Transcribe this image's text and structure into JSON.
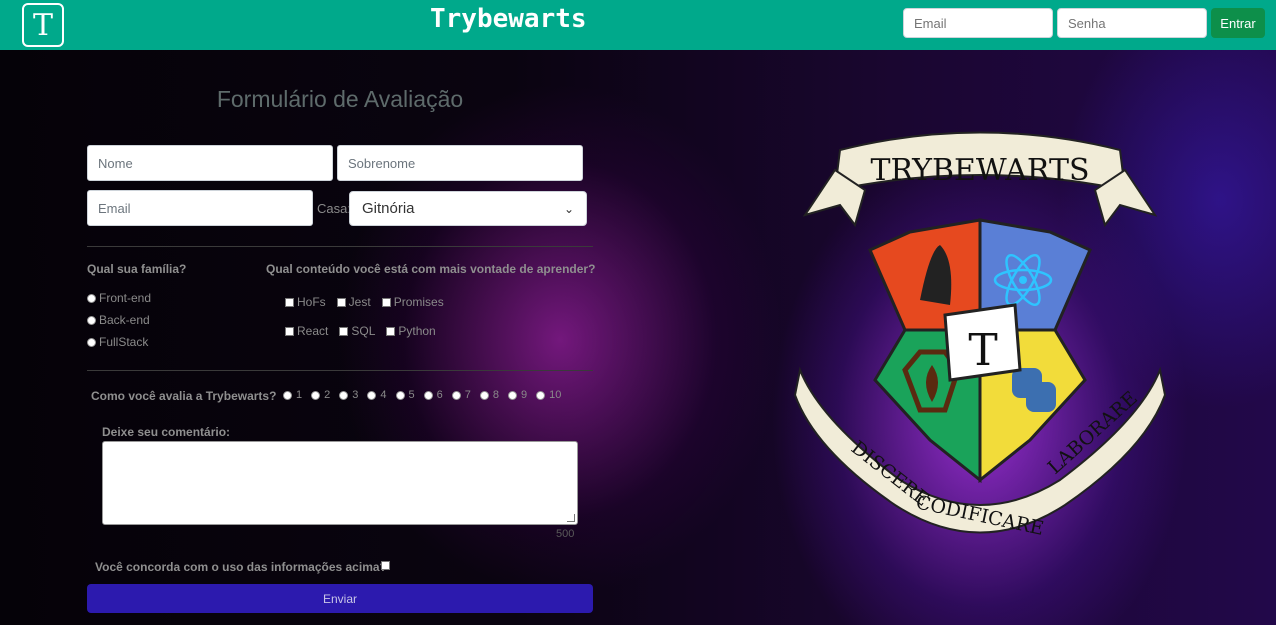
{
  "header": {
    "logo_letter": "T",
    "title": "Trybewarts",
    "login": {
      "email_placeholder": "Email",
      "password_placeholder": "Senha",
      "button_label": "Entrar"
    },
    "color": "#00a98b"
  },
  "form": {
    "title": "Formulário de Avaliação",
    "name_placeholder": "Nome",
    "lastname_placeholder": "Sobrenome",
    "email_placeholder": "Email",
    "house_label": "Casa:",
    "house_selected": "Gitnória",
    "family_question": "Qual sua família?",
    "family_options": [
      "Front-end",
      "Back-end",
      "FullStack"
    ],
    "content_question": "Qual conteúdo você está com mais vontade de aprender?",
    "content_options_row1": [
      "HoFs",
      "Jest",
      "Promises"
    ],
    "content_options_row2": [
      "React",
      "SQL",
      "Python"
    ],
    "rating_question": "Como você avalia a Trybewarts?",
    "rating_options": [
      "1",
      "2",
      "3",
      "4",
      "5",
      "6",
      "7",
      "8",
      "9",
      "10"
    ],
    "comment_label": "Deixe seu comentário:",
    "counter": "500",
    "agreement_label": "Você concorda com o uso das informações acima?",
    "submit_label": "Enviar",
    "submit_color": "#2c1aae"
  },
  "crest": {
    "banner_top": "TRYBEWARTS",
    "center_letter": "T",
    "motto": [
      "DISCERE",
      "CODIFICARE",
      "LABORARE"
    ],
    "quadrant_colors": [
      "#e6491f",
      "#5a7fd6",
      "#1aa35a",
      "#f2dc3a"
    ]
  }
}
